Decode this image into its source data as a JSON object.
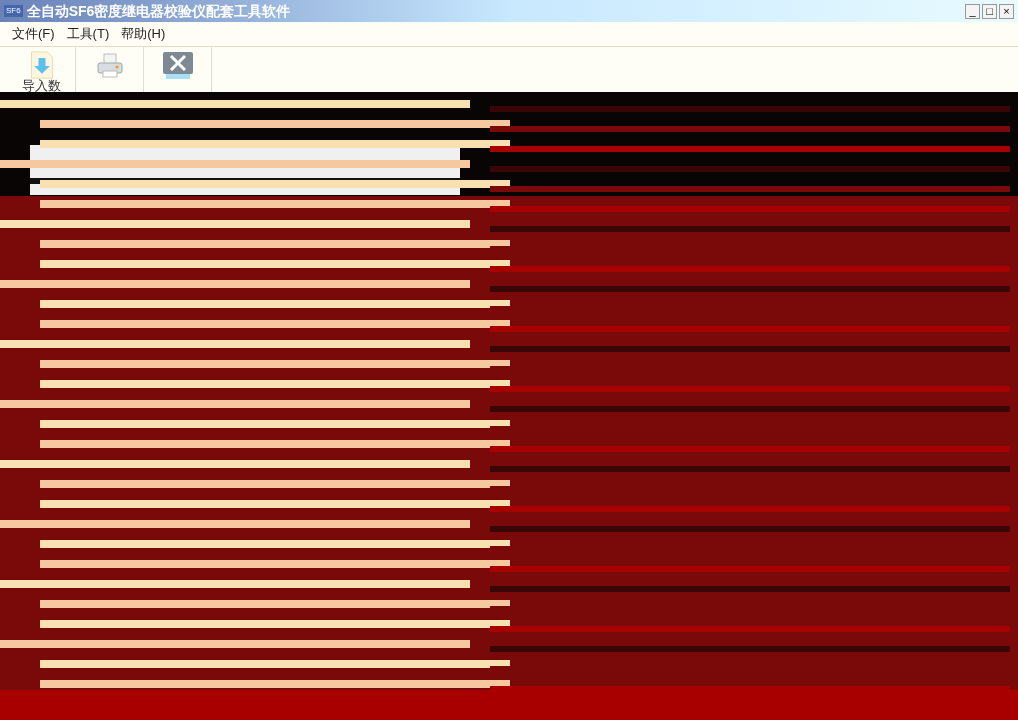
{
  "window": {
    "title": "全自动SF6密度继电器校验仪配套工具软件",
    "icon_text": "SF6",
    "controls": [
      "_",
      "□",
      "×"
    ]
  },
  "menu": [
    "文件(F)",
    "工具(T)",
    "帮助(H)"
  ],
  "toolbar": [
    {
      "kind": "import",
      "label": "导入数"
    },
    {
      "kind": "print"
    },
    {
      "kind": "close"
    }
  ]
}
